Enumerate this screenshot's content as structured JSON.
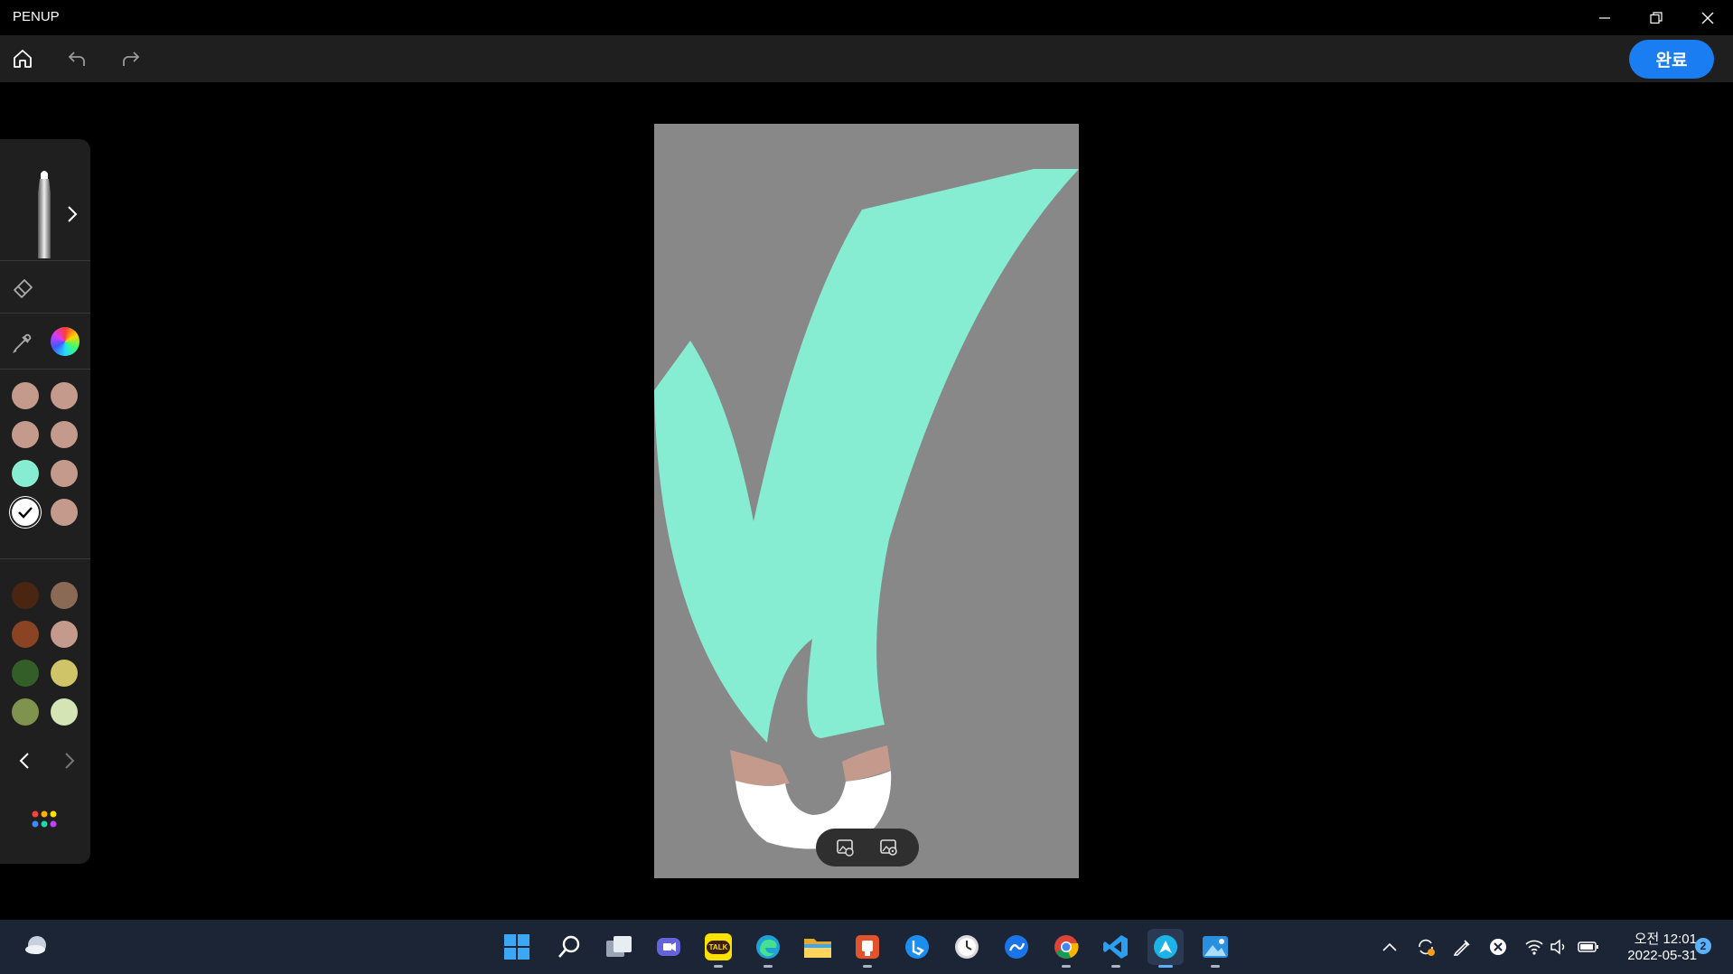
{
  "window": {
    "title": "PENUP"
  },
  "toolbar": {
    "done_label": "완료"
  },
  "palette": {
    "top_swatches": [
      {
        "color": "#c49a8c",
        "selected": false
      },
      {
        "color": "#c49a8c",
        "selected": false
      },
      {
        "color": "#c49a8c",
        "selected": false
      },
      {
        "color": "#c49a8c",
        "selected": false
      },
      {
        "color": "#86ecd2",
        "selected": false
      },
      {
        "color": "#c49a8c",
        "selected": false
      },
      {
        "color": "#ffffff",
        "selected": true
      },
      {
        "color": "#c49a8c",
        "selected": false
      }
    ],
    "bottom_swatches": [
      {
        "color": "#4a2612"
      },
      {
        "color": "#8a6a55"
      },
      {
        "color": "#8a4424"
      },
      {
        "color": "#c49a8c"
      },
      {
        "color": "#345e28"
      },
      {
        "color": "#cfc468"
      },
      {
        "color": "#7f924e"
      },
      {
        "color": "#d4e4b4"
      }
    ]
  },
  "colors": {
    "canvas_bg": "#888888",
    "stroke_mint": "#86ecd2",
    "stroke_skin": "#c49a8c",
    "accent": "#1a7ef2"
  },
  "taskbar": {
    "icons": [
      "weather-icon",
      "start-icon",
      "search-icon",
      "task-view-icon",
      "teams-chat-icon",
      "kakaotalk-icon",
      "edge-icon",
      "file-explorer-icon",
      "powerpoint-icon",
      "bing-icon",
      "clock-app-icon",
      "flow-app-icon",
      "chrome-icon",
      "vscode-icon",
      "penup-icon",
      "photos-icon"
    ],
    "kakaotalk_label": "TALK",
    "clock_time": "오전 12:01",
    "clock_date": "2022-05-31",
    "notification_count": "2"
  }
}
